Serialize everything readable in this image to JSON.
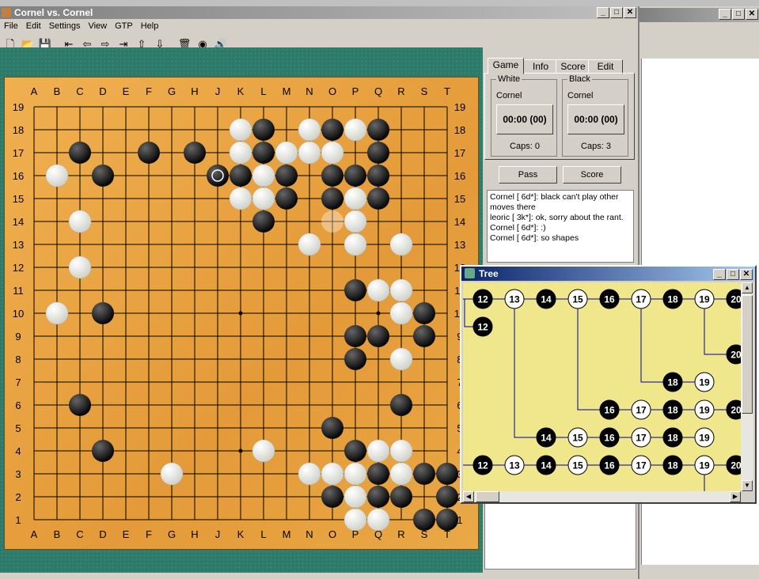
{
  "window": {
    "title": "Cornel vs. Cornel"
  },
  "menu": [
    "File",
    "Edit",
    "Settings",
    "View",
    "GTP",
    "Help"
  ],
  "toolbar": [
    {
      "name": "new-icon",
      "glyph": "🗋"
    },
    {
      "name": "open-icon",
      "glyph": "📂"
    },
    {
      "name": "save-icon",
      "glyph": "💾"
    },
    {
      "name": "first-move-icon",
      "glyph": "⇤"
    },
    {
      "name": "prev-move-icon",
      "glyph": "⇦"
    },
    {
      "name": "next-move-icon",
      "glyph": "⇨"
    },
    {
      "name": "last-move-icon",
      "glyph": "⇥"
    },
    {
      "name": "up-variation-icon",
      "glyph": "⇧"
    },
    {
      "name": "down-variation-icon",
      "glyph": "⇩"
    },
    {
      "name": "delete-icon",
      "glyph": "🗑"
    },
    {
      "name": "info-icon",
      "glyph": "◉"
    },
    {
      "name": "sound-icon",
      "glyph": "🔊"
    }
  ],
  "board": {
    "size": 19,
    "columns": [
      "A",
      "B",
      "C",
      "D",
      "E",
      "F",
      "G",
      "H",
      "J",
      "K",
      "L",
      "M",
      "N",
      "O",
      "P",
      "Q",
      "R",
      "S",
      "T"
    ],
    "rows": [
      "19",
      "18",
      "17",
      "16",
      "15",
      "14",
      "13",
      "12",
      "11",
      "10",
      "9",
      "8",
      "7",
      "6",
      "5",
      "4",
      "3",
      "2",
      "1"
    ],
    "hoshi": [
      "D16",
      "K16",
      "Q16",
      "D10",
      "K10",
      "Q10",
      "D4",
      "K4",
      "Q4"
    ],
    "black": [
      "L18",
      "O18",
      "Q18",
      "C17",
      "F17",
      "H17",
      "L17",
      "Q17",
      "D16",
      "J16",
      "K16",
      "M16",
      "O16",
      "P16",
      "Q16",
      "M15",
      "O15",
      "Q15",
      "L14",
      "P11",
      "D10",
      "S10",
      "P9",
      "Q9",
      "S9",
      "P8",
      "C6",
      "R6",
      "O5",
      "D4",
      "P4",
      "Q3",
      "S3",
      "T3",
      "O2",
      "Q2",
      "R2",
      "T2",
      "S1",
      "T1"
    ],
    "white": [
      "K18",
      "N18",
      "P18",
      "K17",
      "M17",
      "N17",
      "O17",
      "B16",
      "L16",
      "K15",
      "L15",
      "P15",
      "C14",
      "P14",
      "N13",
      "P13",
      "R13",
      "C12",
      "Q11",
      "R11",
      "B10",
      "R10",
      "R8",
      "L4",
      "Q4",
      "R4",
      "G3",
      "N3",
      "O3",
      "P3",
      "R3",
      "P2",
      "P1",
      "Q1"
    ],
    "last_move": "J16",
    "ghost": "O14"
  },
  "tabs": [
    "Game",
    "Info",
    "Score",
    "Edit"
  ],
  "white_player": {
    "label": "White",
    "name": "Cornel",
    "clock": "00:00 (00)",
    "caps": "Caps:  0"
  },
  "black_player": {
    "label": "Black",
    "name": "Cornel",
    "clock": "00:00 (00)",
    "caps": "Caps:  3"
  },
  "buttons": {
    "pass": "Pass",
    "score": "Score"
  },
  "chat": [
    "Cornel [ 6d*]: black can't play other moves there",
    "leoric [ 3k*]: ok, sorry about the rant.",
    "Cornel [ 6d*]: :)",
    "Cornel [ 6d*]: so shapes"
  ],
  "tree": {
    "title": "Tree",
    "nodes": [
      {
        "c": 0,
        "r": 0,
        "n": "12",
        "color": "black"
      },
      {
        "c": 1,
        "r": 0,
        "n": "13",
        "color": "white"
      },
      {
        "c": 2,
        "r": 0,
        "n": "14",
        "color": "black"
      },
      {
        "c": 3,
        "r": 0,
        "n": "15",
        "color": "white"
      },
      {
        "c": 4,
        "r": 0,
        "n": "16",
        "color": "black"
      },
      {
        "c": 5,
        "r": 0,
        "n": "17",
        "color": "white"
      },
      {
        "c": 6,
        "r": 0,
        "n": "18",
        "color": "black"
      },
      {
        "c": 7,
        "r": 0,
        "n": "19",
        "color": "white"
      },
      {
        "c": 8,
        "r": 0,
        "n": "20",
        "color": "black"
      },
      {
        "c": 0,
        "r": 1,
        "n": "12",
        "color": "black"
      },
      {
        "c": 8,
        "r": 2,
        "n": "20",
        "color": "black"
      },
      {
        "c": 6,
        "r": 3,
        "n": "18",
        "color": "black"
      },
      {
        "c": 7,
        "r": 3,
        "n": "19",
        "color": "white"
      },
      {
        "c": 4,
        "r": 4,
        "n": "16",
        "color": "black"
      },
      {
        "c": 5,
        "r": 4,
        "n": "17",
        "color": "white"
      },
      {
        "c": 6,
        "r": 4,
        "n": "18",
        "color": "black"
      },
      {
        "c": 7,
        "r": 4,
        "n": "19",
        "color": "white"
      },
      {
        "c": 8,
        "r": 4,
        "n": "20",
        "color": "black"
      },
      {
        "c": 2,
        "r": 5,
        "n": "14",
        "color": "black"
      },
      {
        "c": 3,
        "r": 5,
        "n": "15",
        "color": "white"
      },
      {
        "c": 4,
        "r": 5,
        "n": "16",
        "color": "black"
      },
      {
        "c": 5,
        "r": 5,
        "n": "17",
        "color": "white"
      },
      {
        "c": 6,
        "r": 5,
        "n": "18",
        "color": "black"
      },
      {
        "c": 7,
        "r": 5,
        "n": "19",
        "color": "white"
      },
      {
        "c": 0,
        "r": 6,
        "n": "12",
        "color": "black"
      },
      {
        "c": 1,
        "r": 6,
        "n": "13",
        "color": "white"
      },
      {
        "c": 2,
        "r": 6,
        "n": "14",
        "color": "black"
      },
      {
        "c": 3,
        "r": 6,
        "n": "15",
        "color": "white"
      },
      {
        "c": 4,
        "r": 6,
        "n": "16",
        "color": "black"
      },
      {
        "c": 5,
        "r": 6,
        "n": "17",
        "color": "white"
      },
      {
        "c": 6,
        "r": 6,
        "n": "18",
        "color": "black"
      },
      {
        "c": 7,
        "r": 6,
        "n": "19",
        "color": "white"
      },
      {
        "c": 8,
        "r": 6,
        "n": "20",
        "color": "black"
      }
    ],
    "branches": [
      {
        "from_c": 0,
        "from_r": 0,
        "to_c": 0,
        "to_r": 1
      },
      {
        "from_c": 1,
        "from_r": 0,
        "to_c": 2,
        "to_r": 5
      },
      {
        "from_c": 3,
        "from_r": 0,
        "to_c": 4,
        "to_r": 4
      },
      {
        "from_c": 5,
        "from_r": 0,
        "to_c": 6,
        "to_r": 3
      },
      {
        "from_c": 7,
        "from_r": 0,
        "to_c": 8,
        "to_r": 2
      },
      {
        "from_c": 7,
        "from_r": 6,
        "to_c": 8,
        "to_r": 7
      }
    ]
  }
}
